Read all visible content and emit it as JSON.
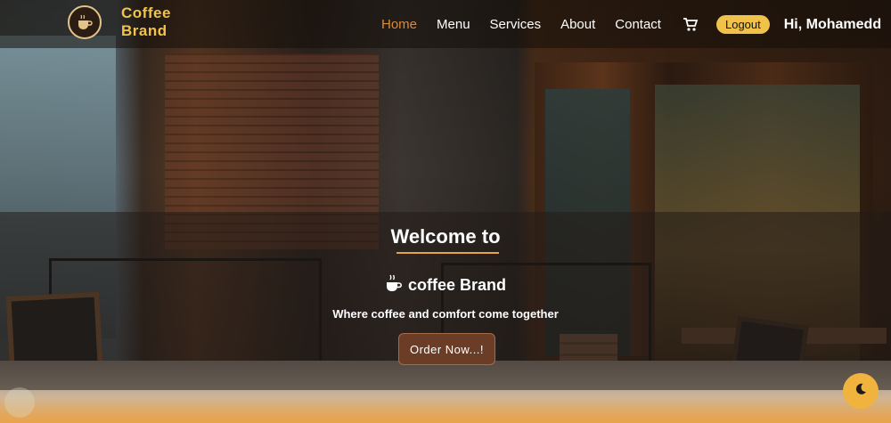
{
  "brand": {
    "name_line1": "Coffee",
    "name_line2": "Brand",
    "logo_icon": "coffee-logo-icon"
  },
  "nav": {
    "items": [
      {
        "label": "Home",
        "active": true
      },
      {
        "label": "Menu",
        "active": false
      },
      {
        "label": "Services",
        "active": false
      },
      {
        "label": "About",
        "active": false
      },
      {
        "label": "Contact",
        "active": false
      }
    ],
    "cart_icon": "cart-icon",
    "logout_label": "Logout",
    "greeting": "Hi, Mohamedd"
  },
  "hero": {
    "title": "Welcome to",
    "subtitle": "coffee Brand",
    "subtitle_icon": "coffee-cup-icon",
    "tagline": "Where coffee and comfort come together",
    "cta_label": "Order Now...!"
  },
  "theme_toggle": {
    "icon": "moon-icon"
  },
  "colors": {
    "accent": "#f0c24a",
    "active_link": "#d98a3a",
    "cta_bg": "#6b3d27",
    "underline": "#e6a24a"
  }
}
